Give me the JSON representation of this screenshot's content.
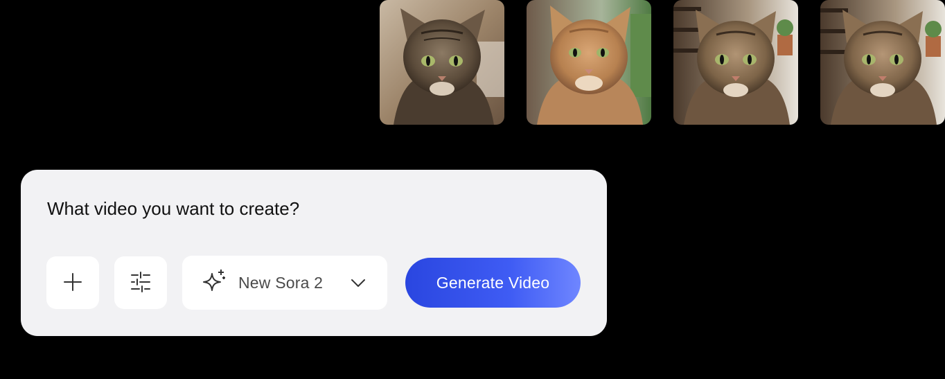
{
  "thumbnails": [
    {
      "name": "tabby cat portrait indoors"
    },
    {
      "name": "orange tabby cat by window"
    },
    {
      "name": "tabby cat in front of bookshelf"
    },
    {
      "name": "tabby cat in front of bookshelf variant"
    }
  ],
  "prompt": {
    "placeholder": "What video you want to create?",
    "value": ""
  },
  "toolbar": {
    "add_icon": "plus-icon",
    "settings_icon": "sliders-icon",
    "model": {
      "icon": "sparkle-icon",
      "selected": "New Sora 2",
      "chevron_icon": "chevron-down-icon"
    },
    "generate_label": "Generate Video"
  },
  "colors": {
    "background": "#000000",
    "card": "#f2f2f4",
    "button_bg": "#ffffff",
    "accent_start": "#2a46e0",
    "accent_end": "#6f86ff",
    "text": "#111111",
    "muted_text": "#4a4a4a"
  }
}
